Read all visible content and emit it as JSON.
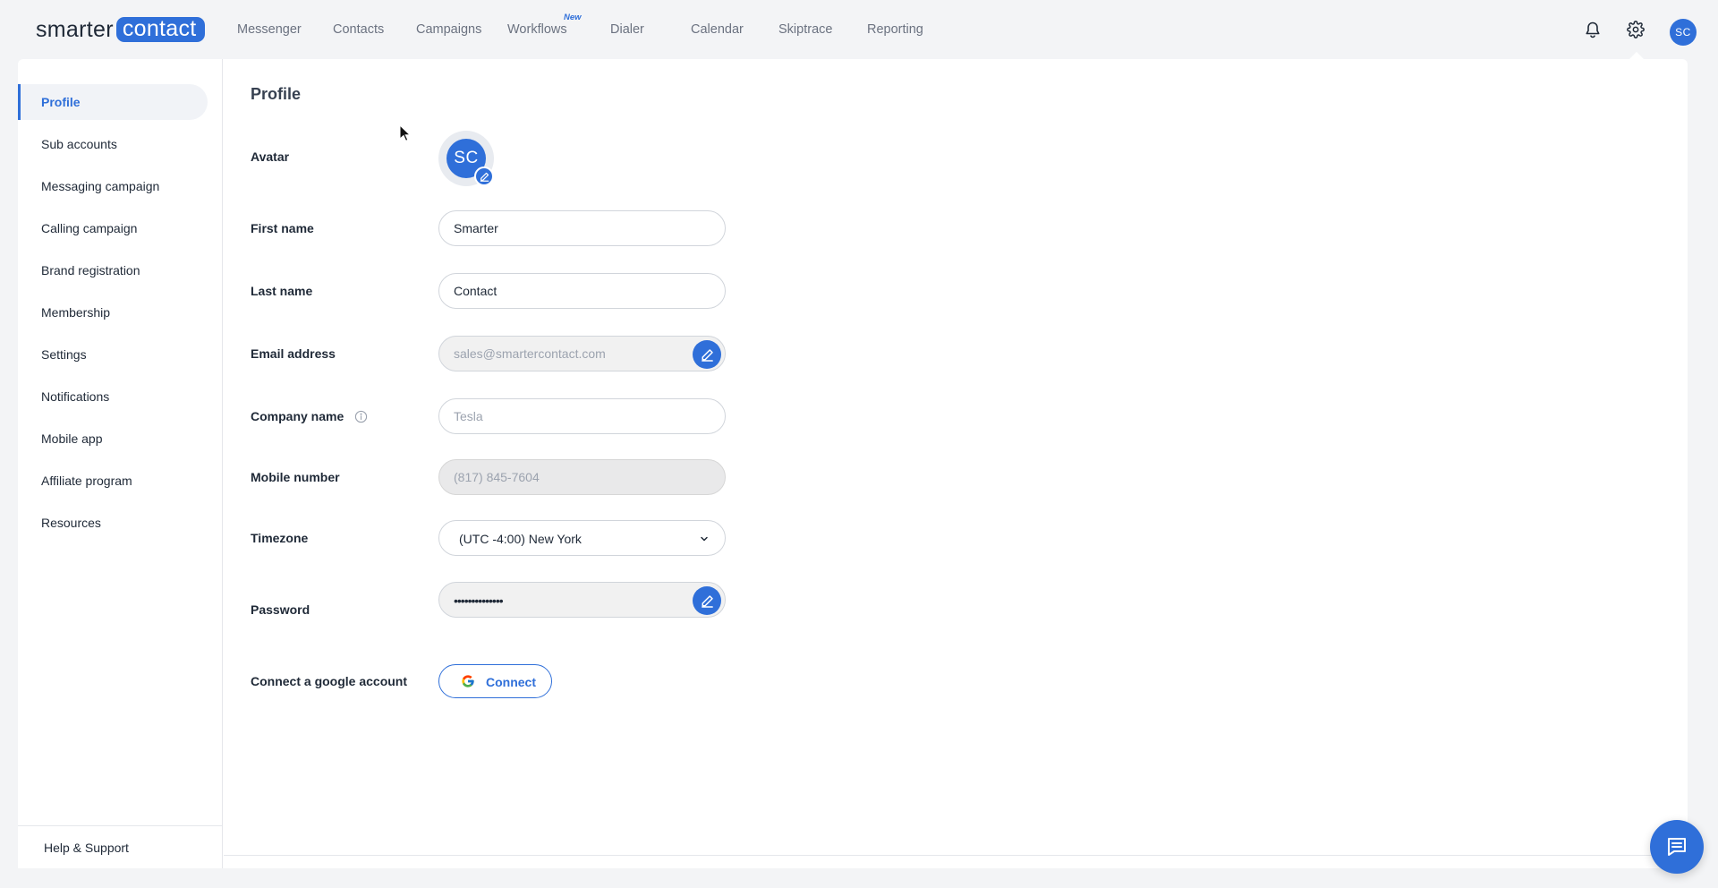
{
  "logo": {
    "left": "smarter",
    "right": "contact"
  },
  "nav": {
    "items": [
      "Messenger",
      "Contacts",
      "Campaigns",
      "Workflows",
      "Dialer",
      "Calendar",
      "Skiptrace",
      "Reporting"
    ],
    "workflows_badge": "New"
  },
  "user": {
    "initials": "SC"
  },
  "sidebar": {
    "items": [
      "Profile",
      "Sub accounts",
      "Messaging campaign",
      "Calling campaign",
      "Brand registration",
      "Membership",
      "Settings",
      "Notifications",
      "Mobile app",
      "Affiliate program",
      "Resources"
    ],
    "active": "Profile",
    "footer": "Help & Support"
  },
  "profile": {
    "title": "Profile",
    "avatar_label": "Avatar",
    "avatar_initials": "SC",
    "first_name_label": "First name",
    "first_name": "Smarter",
    "last_name_label": "Last name",
    "last_name": "Contact",
    "email_label": "Email address",
    "email": "sales@smartercontact.com",
    "company_label": "Company name",
    "company_placeholder": "Tesla",
    "mobile_label": "Mobile number",
    "mobile": "(817) 845-7604",
    "timezone_label": "Timezone",
    "timezone": "(UTC -4:00) New York",
    "password_label": "Password",
    "password": "••••••••••••••",
    "google_label": "Connect a google account",
    "connect_button": "Connect"
  },
  "colors": {
    "accent": "#2f6fd9",
    "background": "#f3f4f6"
  }
}
